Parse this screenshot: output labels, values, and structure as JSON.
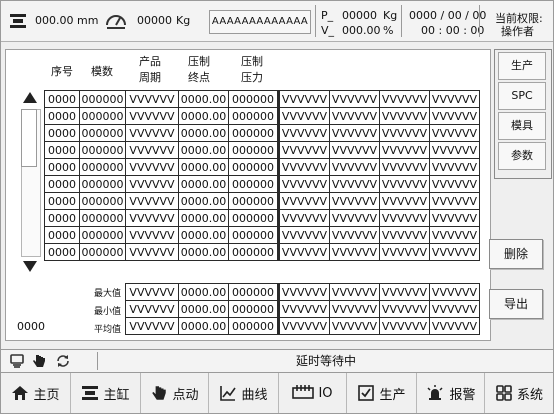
{
  "header": {
    "weight_value": "000.00",
    "weight_unit": "mm",
    "force_value": "00000",
    "force_unit": "Kg",
    "model": "AAAAAAAAAAAAA",
    "p_label": "P_",
    "p_value": "00000",
    "p_unit": "Kg",
    "v_label": "V_",
    "v_value": "000.00",
    "v_unit": "%",
    "date": "0000 / 00 / 00",
    "time": "00 : 00 : 00",
    "permission_label": "当前权限:",
    "permission_value": "操作者"
  },
  "table": {
    "headers": {
      "seq": "序号",
      "die_count": "模数",
      "cycle_line1": "产品",
      "cycle_line2": "周期",
      "endpoint_line1": "压制",
      "endpoint_line2": "终点",
      "pressure_line1": "压制",
      "pressure_line2": "压力"
    },
    "rows": [
      [
        "0000",
        "000000",
        "VVVVVV",
        "0000.00",
        "000000",
        "VVVVVV",
        "VVVVVV",
        "VVVVVV",
        "VVVVVV"
      ],
      [
        "0000",
        "000000",
        "VVVVVV",
        "0000.00",
        "000000",
        "VVVVVV",
        "VVVVVV",
        "VVVVVV",
        "VVVVVV"
      ],
      [
        "0000",
        "000000",
        "VVVVVV",
        "0000.00",
        "000000",
        "VVVVVV",
        "VVVVVV",
        "VVVVVV",
        "VVVVVV"
      ],
      [
        "0000",
        "000000",
        "VVVVVV",
        "0000.00",
        "000000",
        "VVVVVV",
        "VVVVVV",
        "VVVVVV",
        "VVVVVV"
      ],
      [
        "0000",
        "000000",
        "VVVVVV",
        "0000.00",
        "000000",
        "VVVVVV",
        "VVVVVV",
        "VVVVVV",
        "VVVVVV"
      ],
      [
        "0000",
        "000000",
        "VVVVVV",
        "0000.00",
        "000000",
        "VVVVVV",
        "VVVVVV",
        "VVVVVV",
        "VVVVVV"
      ],
      [
        "0000",
        "000000",
        "VVVVVV",
        "0000.00",
        "000000",
        "VVVVVV",
        "VVVVVV",
        "VVVVVV",
        "VVVVVV"
      ],
      [
        "0000",
        "000000",
        "VVVVVV",
        "0000.00",
        "000000",
        "VVVVVV",
        "VVVVVV",
        "VVVVVV",
        "VVVVVV"
      ],
      [
        "0000",
        "000000",
        "VVVVVV",
        "0000.00",
        "000000",
        "VVVVVV",
        "VVVVVV",
        "VVVVVV",
        "VVVVVV"
      ],
      [
        "0000",
        "000000",
        "VVVVVV",
        "0000.00",
        "000000",
        "VVVVVV",
        "VVVVVV",
        "VVVVVV",
        "VVVVVV"
      ]
    ],
    "stats": [
      {
        "label": "最大值",
        "values": [
          "VVVVVV",
          "0000.00",
          "000000",
          "VVVVVV",
          "VVVVVV",
          "VVVVVV",
          "VVVVVV"
        ]
      },
      {
        "label": "最小值",
        "values": [
          "VVVVVV",
          "0000.00",
          "000000",
          "VVVVVV",
          "VVVVVV",
          "VVVVVV",
          "VVVVVV"
        ]
      },
      {
        "label": "平均值",
        "values": [
          "VVVVVV",
          "0000.00",
          "000000",
          "VVVVVV",
          "VVVVVV",
          "VVVVVV",
          "VVVVVV"
        ]
      }
    ],
    "record_count": "0000"
  },
  "side_tabs": [
    "生产",
    "SPC",
    "模具",
    "参数"
  ],
  "actions": {
    "delete": "删除",
    "export": "导出"
  },
  "status": {
    "message": "延时等待中"
  },
  "nav": [
    "主页",
    "主缸",
    "点动",
    "曲线",
    "IO",
    "生产",
    "报警",
    "系统"
  ]
}
